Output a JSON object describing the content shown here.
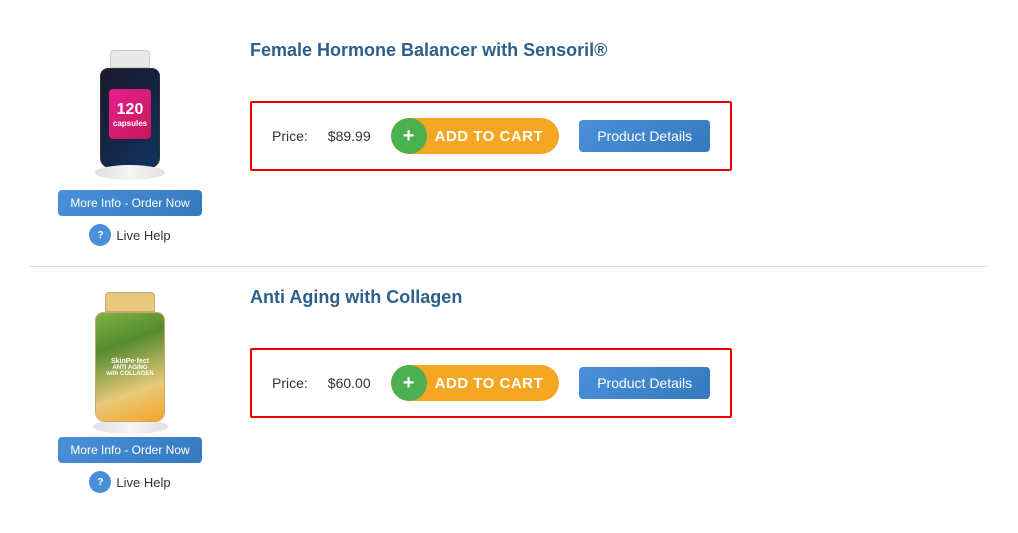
{
  "products": [
    {
      "id": "product-1",
      "name": "Female Hormone Balancer with Sensoril®",
      "price": "$89.99",
      "price_label": "Price:",
      "add_to_cart_label": "ADD TO CART",
      "product_details_label": "Product Details",
      "more_info_label": "More Info - Order Now",
      "live_help_label": "Live Help",
      "bottle_type": "bottle-1",
      "bottle_number": "120"
    },
    {
      "id": "product-2",
      "name": "Anti Aging with Collagen",
      "price": "$60.00",
      "price_label": "Price:",
      "add_to_cart_label": "ADD TO CART",
      "product_details_label": "Product Details",
      "more_info_label": "More Info - Order Now",
      "live_help_label": "Live Help",
      "bottle_type": "bottle-2",
      "bottle_brand": "SkinPerfect"
    }
  ],
  "icons": {
    "plus": "+",
    "live_help_char": "?"
  }
}
